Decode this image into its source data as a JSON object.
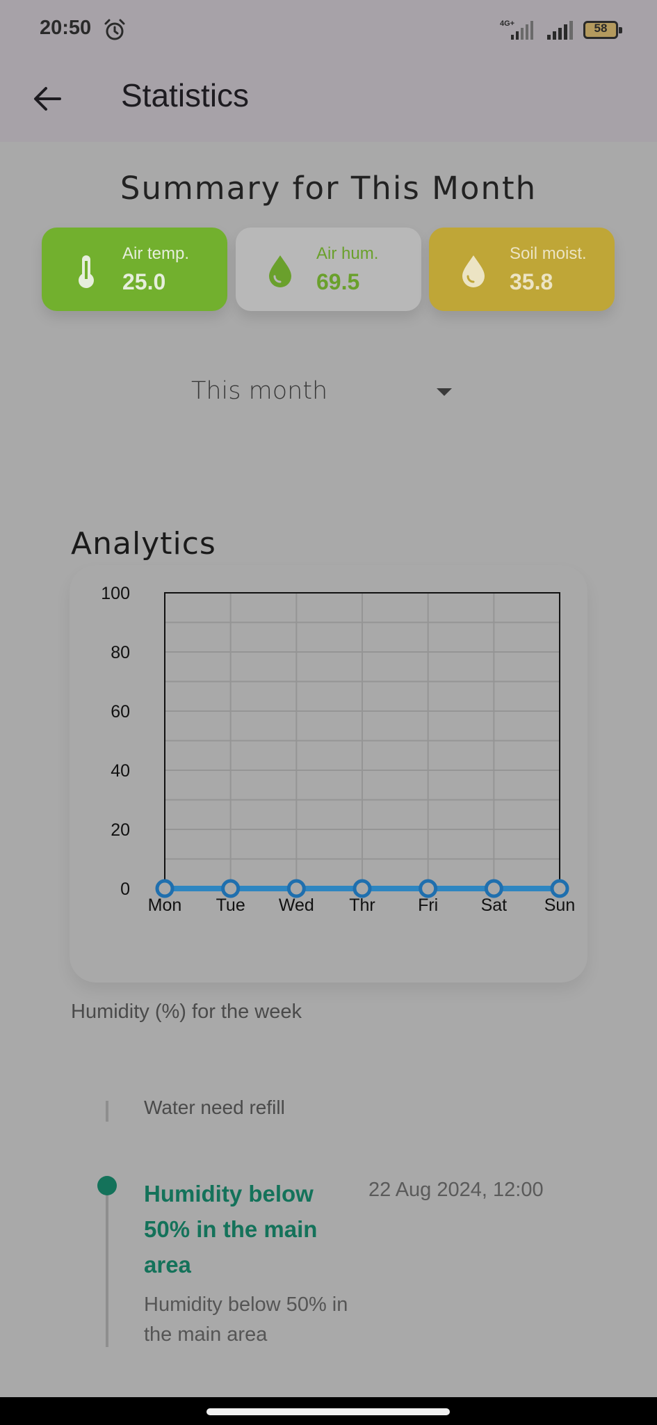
{
  "status_bar": {
    "time": "20:50",
    "network": "4G+",
    "battery": "58"
  },
  "app_bar": {
    "title": "Statistics"
  },
  "summary": {
    "title": "Summary for This Month",
    "cards": [
      {
        "label": "Air temp.",
        "value": "25.0",
        "icon": "thermometer-icon",
        "color": "#72b02e"
      },
      {
        "label": "Air hum.",
        "value": "69.5",
        "icon": "water-drop-icon",
        "color": "#b8b8b8"
      },
      {
        "label": "Soil moist.",
        "value": "35.8",
        "icon": "water-drop-icon",
        "color": "#bfa637"
      }
    ]
  },
  "period_select": {
    "value": "This month"
  },
  "analytics": {
    "title": "Analytics",
    "caption": "Humidity (%) for the week"
  },
  "chart_data": {
    "type": "line",
    "categories": [
      "Mon",
      "Tue",
      "Wed",
      "Thr",
      "Fri",
      "Sat",
      "Sun"
    ],
    "series": [
      {
        "values": [
          0,
          0,
          0,
          0,
          0,
          0,
          0
        ],
        "color": "#2e86c1"
      }
    ],
    "ylim": [
      0,
      100
    ],
    "yticks": [
      0,
      20,
      40,
      60,
      80,
      100
    ],
    "grid": true
  },
  "timeline": {
    "clipped_item": "Water need refill",
    "items": [
      {
        "title": "Humidity below 50% in the main area",
        "date": "22 Aug 2024, 12:00",
        "description": "Humidity below 50% in the main area",
        "color": "#14725a"
      }
    ]
  }
}
